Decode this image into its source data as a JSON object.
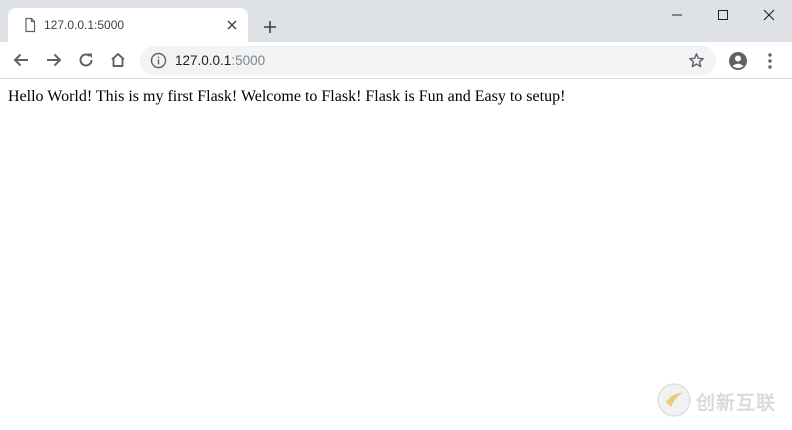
{
  "browser": {
    "tab": {
      "title": "127.0.0.1:5000"
    },
    "address_bar": {
      "host": "127.0.0.1",
      "port": ":5000"
    }
  },
  "icons": {
    "favicon": "page-icon",
    "tab_close": "close-icon",
    "new_tab": "plus-icon",
    "minimize": "minimize-icon",
    "maximize": "maximize-icon",
    "close_window": "close-icon",
    "back": "arrow-left-icon",
    "forward": "arrow-right-icon",
    "reload": "reload-icon",
    "home": "home-icon",
    "site_info": "info-icon",
    "bookmark": "star-icon",
    "profile": "account-icon",
    "menu": "kebab-menu-icon"
  },
  "page": {
    "text": "Hello World! This is my first Flask! Welcome to Flask! Flask is Fun and Easy to setup!"
  },
  "watermark": {
    "text": "创新互联"
  },
  "colors": {
    "titlebar": "#dee1e6",
    "omnibox": "#f1f3f4",
    "icon": "#5f6368",
    "watermark_accent": "#f0a21e"
  }
}
